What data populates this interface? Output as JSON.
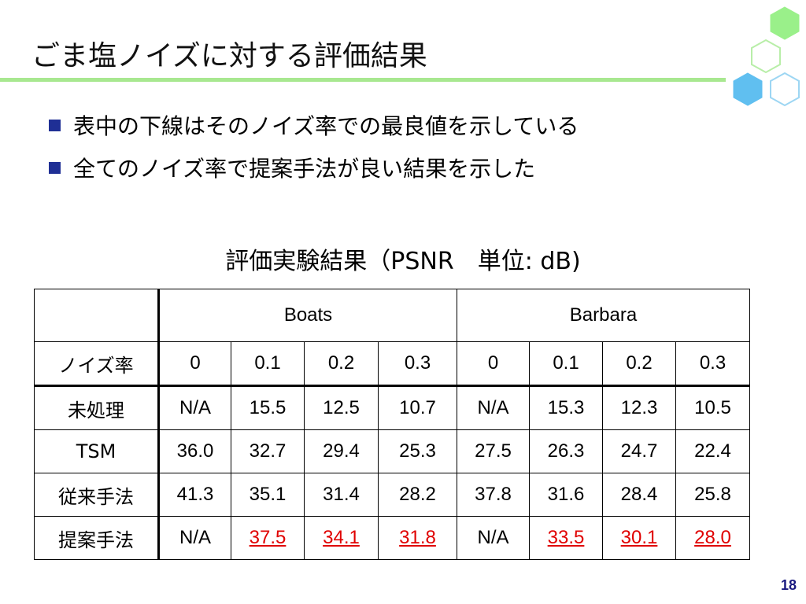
{
  "slide": {
    "title": "ごま塩ノイズに対する評価結果",
    "page_number": "18",
    "accent_color": "#a8e890"
  },
  "bullets": [
    "表中の下線はそのノイズ率での最良値を示している",
    "全てのノイズ率で提案手法が良い結果を示した"
  ],
  "table": {
    "caption": "評価実験結果（PSNR　単位: dB)",
    "groups": [
      "Boats",
      "Barbara"
    ],
    "noise_label": "ノイズ率",
    "noise_levels": [
      "0",
      "0.1",
      "0.2",
      "0.3",
      "0",
      "0.1",
      "0.2",
      "0.3"
    ],
    "rows": [
      {
        "method": "未処理",
        "values": [
          "N/A",
          "15.5",
          "12.5",
          "10.7",
          "N/A",
          "15.3",
          "12.3",
          "10.5"
        ]
      },
      {
        "method": "TSM",
        "values": [
          "36.0",
          "32.7",
          "29.4",
          "25.3",
          "27.5",
          "26.3",
          "24.7",
          "22.4"
        ]
      },
      {
        "method": "従来手法",
        "values": [
          "41.3",
          "35.1",
          "31.4",
          "28.2",
          "37.8",
          "31.6",
          "28.4",
          "25.8"
        ]
      },
      {
        "method": "提案手法",
        "values": [
          "N/A",
          "37.5",
          "34.1",
          "31.8",
          "N/A",
          "33.5",
          "30.1",
          "28.0"
        ]
      }
    ],
    "highlight_color": "#e00000"
  }
}
